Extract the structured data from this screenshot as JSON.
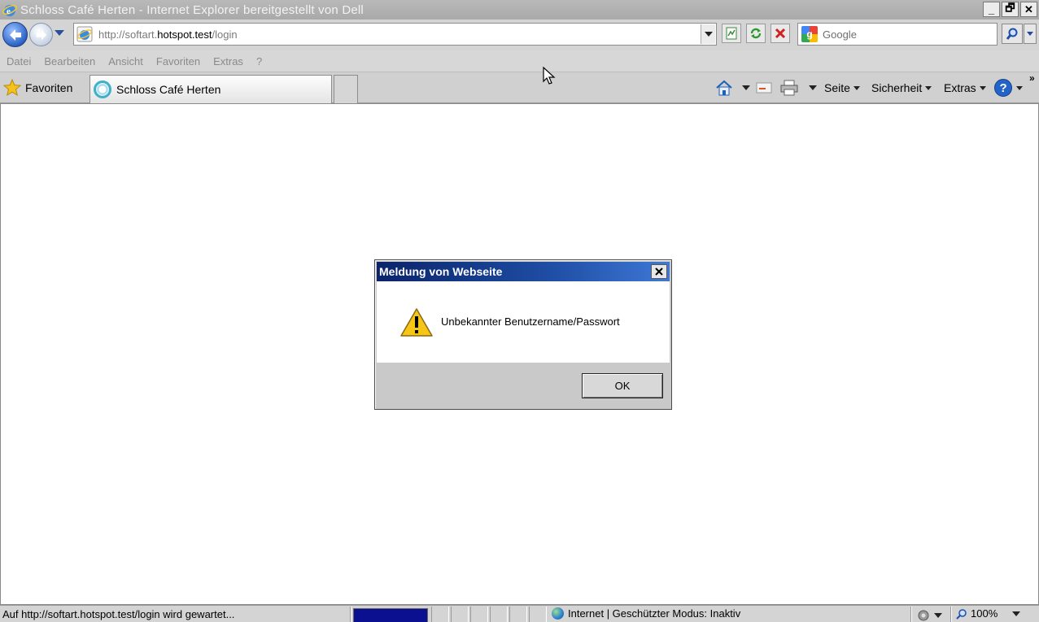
{
  "window": {
    "title": "Schloss Café Herten - Internet Explorer bereitgestellt von Dell",
    "minimize_label": "_",
    "restore_label": "🗗",
    "close_label": "✕"
  },
  "address": {
    "url_prefix": "http://softart.",
    "url_domain": "hotspot.test",
    "url_suffix": "/login"
  },
  "search": {
    "placeholder": "Google"
  },
  "menu": {
    "items": [
      "Datei",
      "Bearbeiten",
      "Ansicht",
      "Favoriten",
      "Extras",
      "?"
    ]
  },
  "favorites_bar": {
    "favorites_label": "Favoriten",
    "tab_label": "Schloss Café Herten"
  },
  "command_bar": {
    "seite": "Seite",
    "sicherheit": "Sicherheit",
    "extras": "Extras"
  },
  "dialog": {
    "title": "Meldung von Webseite",
    "message": "Unbekannter Benutzername/Passwort",
    "ok_label": "OK"
  },
  "status": {
    "text": "Auf http://softart.hotspot.test/login wird gewartet...",
    "zone": "Internet | Geschützter Modus: Inaktiv",
    "zoom": "100%"
  },
  "colors": {
    "dialog_title_start": "#0a246a",
    "dialog_title_end": "#3f78d6",
    "progress": "#0a1090"
  }
}
